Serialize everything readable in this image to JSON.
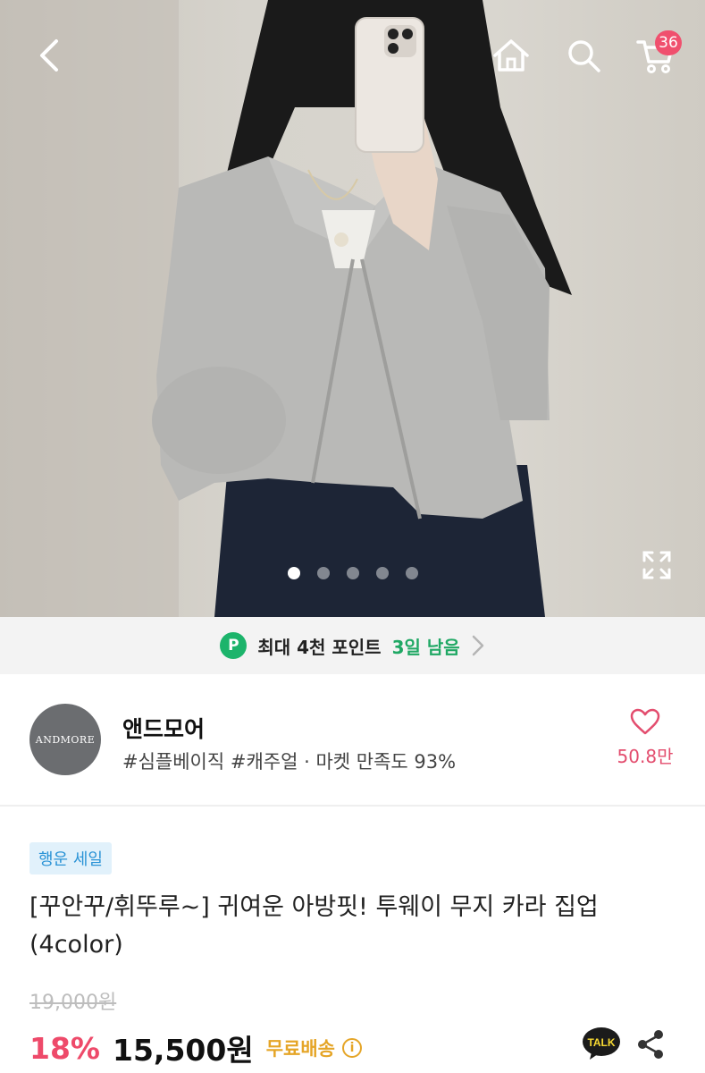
{
  "topbar": {
    "back_icon": "chevron-left-icon",
    "home_icon": "home-icon",
    "search_icon": "search-icon",
    "cart_icon": "cart-icon",
    "cart_count": "36"
  },
  "gallery": {
    "total_slides": 5,
    "active_slide": 1,
    "expand_icon": "expand-icon"
  },
  "point_banner": {
    "badge": "P",
    "text": "최대 4천 포인트",
    "days": "3일 남음",
    "arrow_icon": "chevron-right-icon"
  },
  "store": {
    "logo_text": "ANDMORE",
    "name": "앤드모어",
    "tags": "#심플베이직 #캐주얼 · 마켓 만족도 93%",
    "fav_icon": "heart-icon",
    "fav_count": "50.8만"
  },
  "product": {
    "sale_badge": "행운 세일",
    "title": "[꾸안꾸/휘뚜루~] 귀여운 아방핏! 투웨이 무지 카라 집업 (4color)",
    "original_price": "19,000원",
    "discount": "18%",
    "price": "15,500원",
    "shipping": "무료배송",
    "talk_label": "TALK",
    "share_icon": "share-icon"
  },
  "colors": {
    "accent_red": "#ee4a6a",
    "point_green": "#1cb46b",
    "shipping_gold": "#e5a527",
    "badge_blue": "#2a93d6"
  }
}
